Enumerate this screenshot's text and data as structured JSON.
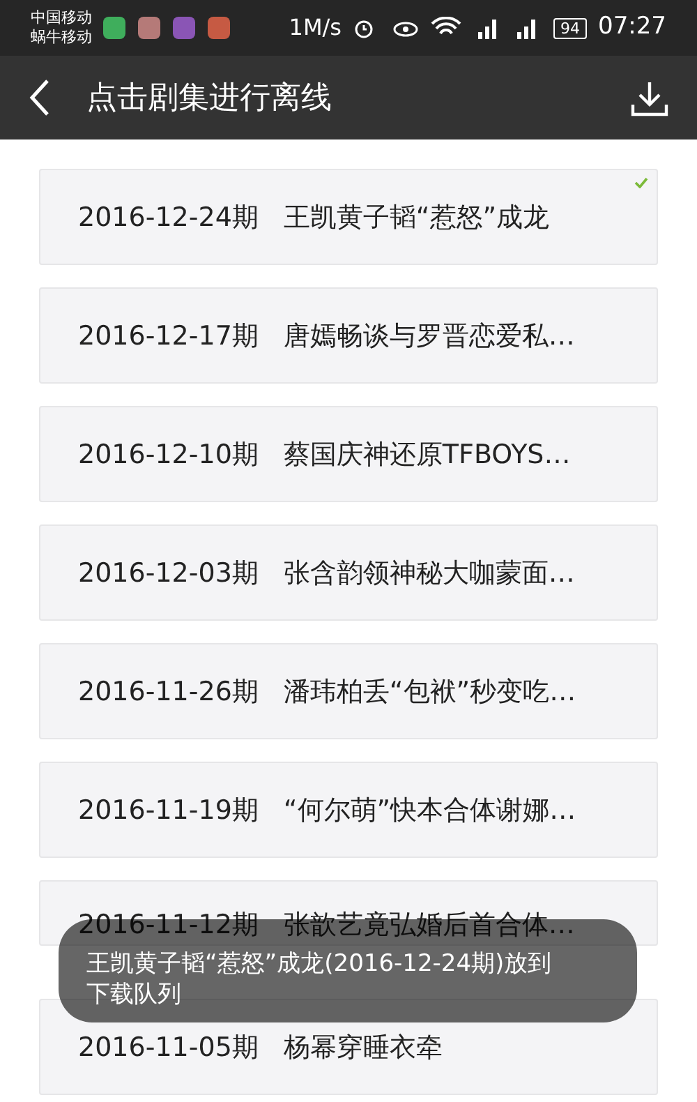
{
  "status_bar": {
    "carriers": [
      "中国移动",
      "蜗牛移动"
    ],
    "speed": "1M/s",
    "battery": "94",
    "time": "07:27"
  },
  "header": {
    "title": "点击剧集进行离线"
  },
  "episodes": [
    {
      "date": "2016-12-24期",
      "title": "王凯黄子韬“惹怒”成龙",
      "checked": true
    },
    {
      "date": "2016-12-17期",
      "title": "唐嫣畅谈与罗晋恋爱私…",
      "checked": false
    },
    {
      "date": "2016-12-10期",
      "title": "蔡国庆神还原TFBOYS…",
      "checked": false
    },
    {
      "date": "2016-12-03期",
      "title": "张含韵领神秘大咖蒙面…",
      "checked": false
    },
    {
      "date": "2016-11-26期",
      "title": "潘玮柏丢“包袱”秒变吃…",
      "checked": false
    },
    {
      "date": "2016-11-19期",
      "title": "“何尔萌”快本合体谢娜…",
      "checked": false
    },
    {
      "date": "2016-11-12期",
      "title": "张歆艺竟弘婚后首合体…",
      "checked": false
    },
    {
      "date": "2016-11-05期",
      "title": "杨幂穿睡衣牵",
      "checked": false
    }
  ],
  "toast": {
    "text": "王凯黄子韬“惹怒”成龙(2016-12-24期)放到下载队列"
  }
}
